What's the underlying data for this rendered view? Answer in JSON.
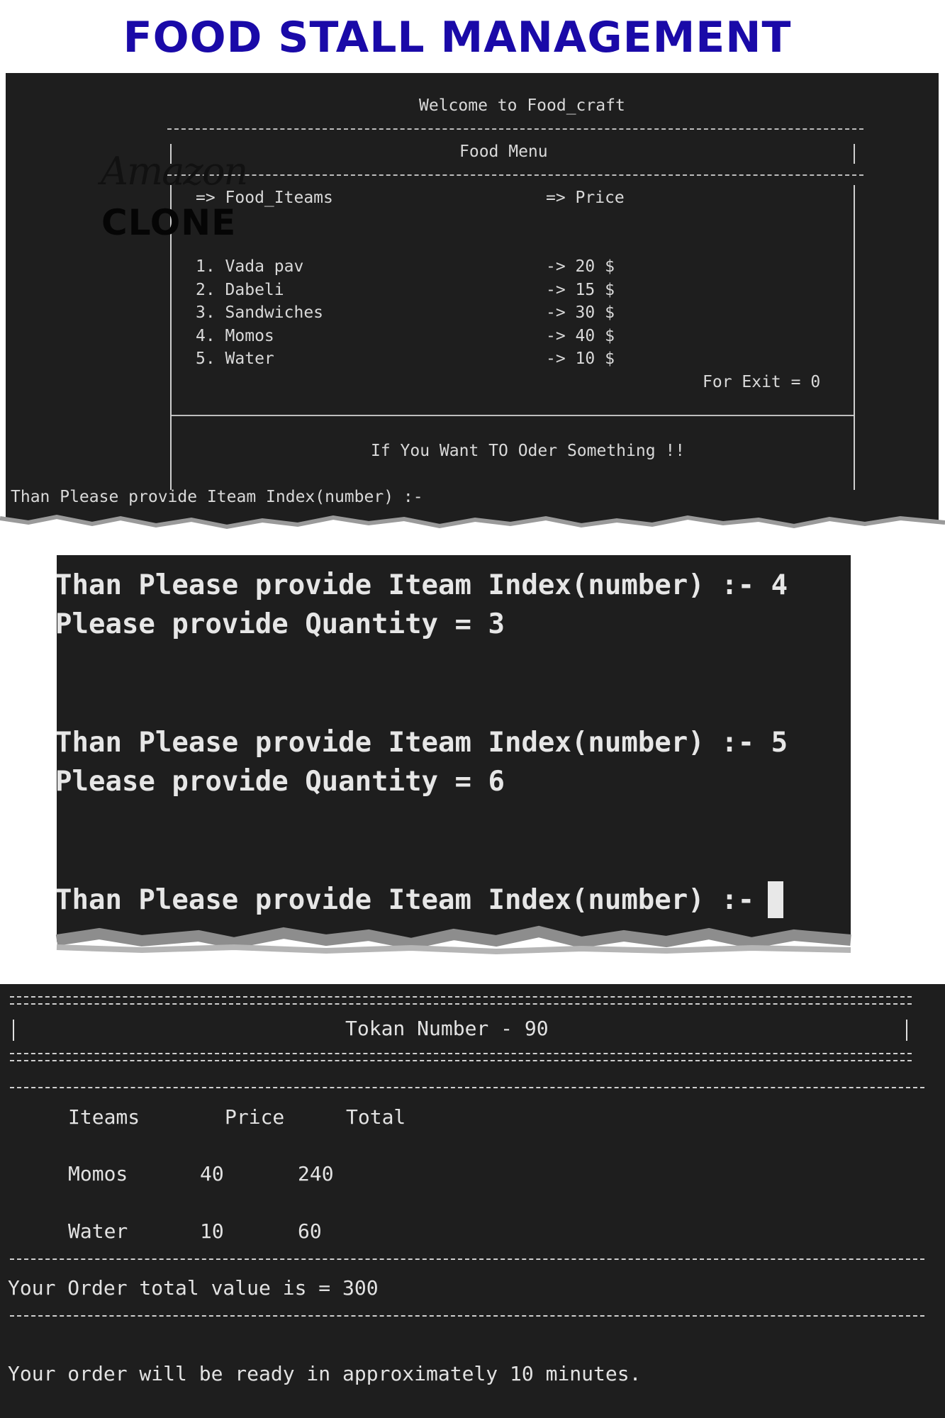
{
  "title": "FOOD STALL MANAGEMENT",
  "logo": {
    "line1": "Amazon",
    "line2": "CLONE"
  },
  "screen1": {
    "welcome": "Welcome to Food_craft",
    "menu_title": "Food Menu",
    "col_items": "=> Food_Iteams",
    "col_price": "=> Price",
    "items": [
      {
        "name": "1. Vada pav",
        "price": "-> 20 $"
      },
      {
        "name": "2. Dabeli",
        "price": "-> 15 $"
      },
      {
        "name": "3. Sandwiches",
        "price": "-> 30 $"
      },
      {
        "name": "4. Momos",
        "price": "-> 40 $"
      },
      {
        "name": "5. Water",
        "price": "-> 10 $"
      }
    ],
    "exit_label": "For Exit = 0",
    "want_order": "If You Want TO Oder Something !!",
    "prompt": "Than Please provide Iteam Index(number) :-"
  },
  "screen2": {
    "lines": [
      "Than Please provide Iteam Index(number) :- 4",
      "Please provide Quantity = 3",
      "Than Please provide Iteam Index(number) :- 5",
      "Please provide Quantity = 6",
      "Than Please provide Iteam Index(number) :- "
    ]
  },
  "screen3": {
    "token": "Tokan Number - 90",
    "headers": {
      "item": "Iteams",
      "price": "Price",
      "total": "Total"
    },
    "rows": [
      {
        "item": "Momos",
        "price": "40",
        "total": "240"
      },
      {
        "item": "Water",
        "price": "10",
        "total": "60"
      }
    ],
    "order_total": "Your Order total value is = 300",
    "ready_msg": "Your order will be ready in approximately 10 minutes."
  }
}
